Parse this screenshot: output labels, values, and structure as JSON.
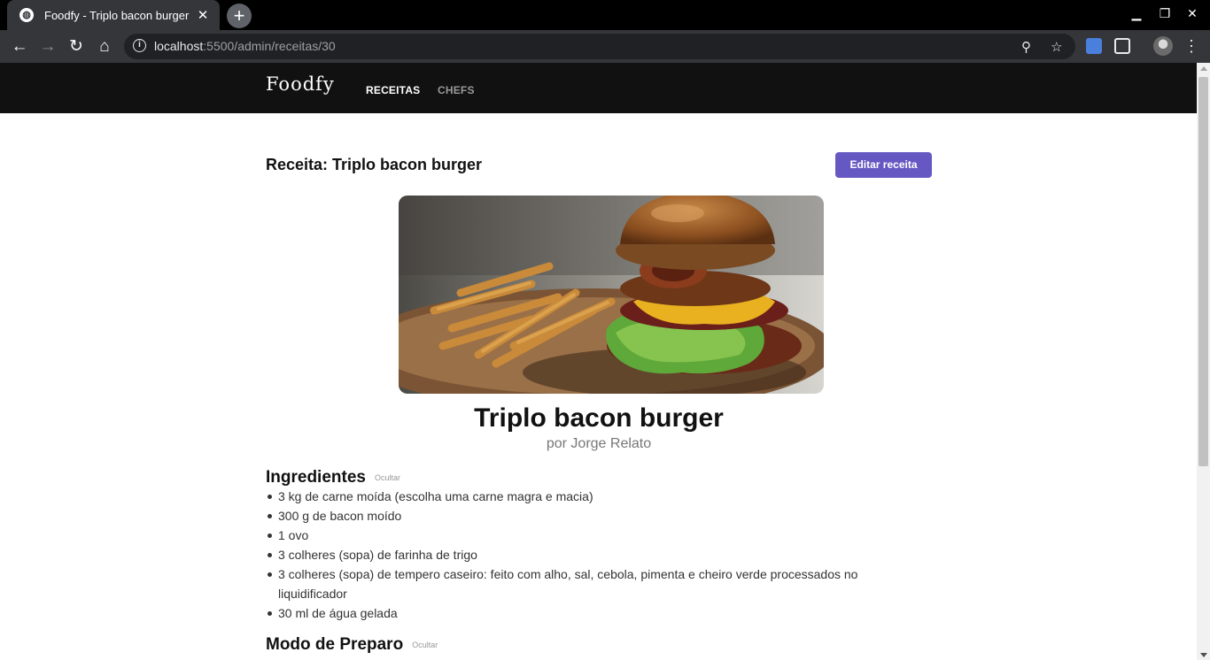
{
  "browser": {
    "tab_title": "Foodfy - Triplo bacon burger",
    "url_host": "localhost",
    "url_rest": ":5500/admin/receitas/30"
  },
  "site": {
    "logo": "Foodfy",
    "nav": [
      {
        "label": "RECEITAS",
        "active": true
      },
      {
        "label": "CHEFS",
        "active": false
      }
    ]
  },
  "page": {
    "heading": "Receita: Triplo bacon burger",
    "edit_button": "Editar receita"
  },
  "recipe": {
    "title": "Triplo bacon burger",
    "author": "por Jorge Relato",
    "ingredients_title": "Ingredientes",
    "ingredients_toggle": "Ocultar",
    "ingredients": [
      "3 kg de carne moída (escolha uma carne magra e macia)",
      "300 g de bacon moído",
      "1 ovo",
      "3 colheres (sopa) de farinha de trigo",
      "3 colheres (sopa) de tempero caseiro: feito com alho, sal, cebola, pimenta e cheiro verde processados no liquidificador",
      "30 ml de água gelada"
    ],
    "preparation_title": "Modo de Preparo",
    "preparation_toggle": "Ocultar"
  }
}
